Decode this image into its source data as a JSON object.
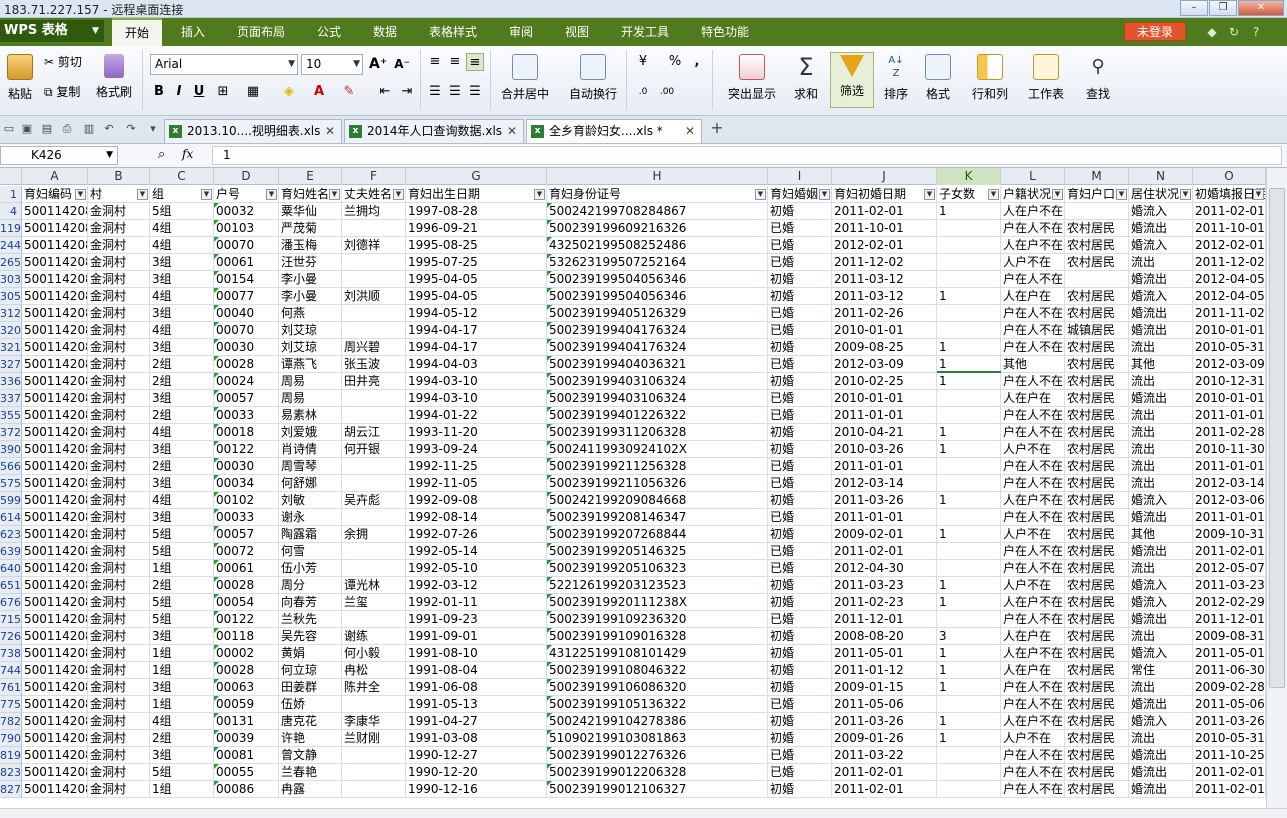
{
  "window": {
    "title": "183.71.227.157 - 远程桌面连接"
  },
  "app": {
    "logo": "WPS 表格",
    "login": "未登录"
  },
  "menu": [
    "开始",
    "插入",
    "页面布局",
    "公式",
    "数据",
    "表格样式",
    "审阅",
    "视图",
    "开发工具",
    "特色功能"
  ],
  "ribbon": {
    "paste": "粘贴",
    "cut": "剪切",
    "copy": "复制",
    "format_painter": "格式刷",
    "font_name": "Arial",
    "font_size": "10",
    "merge_center": "合并居中",
    "wrap_text": "自动换行",
    "percent": "%",
    "highlight": "突出显示",
    "sum": "求和",
    "filter": "筛选",
    "sort": "排序",
    "format": "格式",
    "rows_cols": "行和列",
    "worksheet": "工作表",
    "find": "查找"
  },
  "tabs": [
    {
      "label": "2013.10....视明细表.xls"
    },
    {
      "label": "2014年人口查询数据.xls"
    },
    {
      "label": "全乡育龄妇女....xls *"
    }
  ],
  "formula": {
    "name_box": "K426",
    "fx": "fx",
    "value": "1"
  },
  "columns": [
    "A",
    "B",
    "C",
    "D",
    "E",
    "F",
    "G",
    "H",
    "I",
    "J",
    "K",
    "L",
    "M",
    "N",
    "O"
  ],
  "header_row": {
    "num": "1",
    "cells": [
      "育妇编码",
      "村",
      "组",
      "户号",
      "育妇姓名",
      "丈夫姓名",
      "育妇出生日期",
      "育妇身份证号",
      "育妇婚姻",
      "育妇初婚日期",
      "子女数",
      "户籍状况",
      "育妇户口",
      "居住状况",
      "初婚填报日期"
    ]
  },
  "rows": [
    {
      "num": "4",
      "cells": [
        "500114208",
        "金洞村",
        "5组",
        "00032",
        "粟华仙",
        "兰拥均",
        "1997-08-28",
        "500242199708284867",
        "初婚",
        "2011-02-01",
        "1",
        "人在户不在",
        "",
        "婚流入",
        "2011-02-01"
      ]
    },
    {
      "num": "119",
      "cells": [
        "500114208",
        "金洞村",
        "4组",
        "00103",
        "严茂菊",
        "",
        "1996-09-21",
        "500239199609216326",
        "已婚",
        "2011-10-01",
        "",
        "户在人不在",
        "农村居民",
        "婚流出",
        "2011-10-01"
      ]
    },
    {
      "num": "244",
      "cells": [
        "500114208",
        "金洞村",
        "4组",
        "00070",
        "潘玉梅",
        "刘德祥",
        "1995-08-25",
        "432502199508252486",
        "已婚",
        "2012-02-01",
        "",
        "人在户不在",
        "农村居民",
        "婚流入",
        "2012-02-01"
      ]
    },
    {
      "num": "265",
      "cells": [
        "500114208",
        "金洞村",
        "3组",
        "00061",
        "汪世芬",
        "",
        "1995-07-25",
        "532623199507252164",
        "已婚",
        "2011-12-02",
        "",
        "人户不在",
        "农村居民",
        "流出",
        "2011-12-02"
      ]
    },
    {
      "num": "303",
      "cells": [
        "500114208",
        "金洞村",
        "3组",
        "00154",
        "李小曼",
        "",
        "1995-04-05",
        "500239199504056346",
        "初婚",
        "2011-03-12",
        "",
        "户在人不在",
        "",
        "婚流出",
        "2012-04-05"
      ]
    },
    {
      "num": "305",
      "cells": [
        "500114208",
        "金洞村",
        "4组",
        "00077",
        "李小曼",
        "刘洪顺",
        "1995-04-05",
        "500239199504056346",
        "初婚",
        "2011-03-12",
        "1",
        "人在户在",
        "农村居民",
        "婚流入",
        "2012-04-05"
      ]
    },
    {
      "num": "312",
      "cells": [
        "500114208",
        "金洞村",
        "3组",
        "00040",
        "何燕",
        "",
        "1994-05-12",
        "500239199405126329",
        "已婚",
        "2011-02-26",
        "",
        "户在人不在",
        "农村居民",
        "婚流出",
        "2011-11-02"
      ]
    },
    {
      "num": "320",
      "cells": [
        "500114208",
        "金洞村",
        "4组",
        "00070",
        "刘艾琼",
        "",
        "1994-04-17",
        "500239199404176324",
        "已婚",
        "2010-01-01",
        "",
        "户在人不在",
        "城镇居民",
        "婚流出",
        "2010-01-01"
      ]
    },
    {
      "num": "321",
      "cells": [
        "500114208",
        "金洞村",
        "3组",
        "00030",
        "刘艾琼",
        "周兴碧",
        "1994-04-17",
        "500239199404176324",
        "初婚",
        "2009-08-25",
        "1",
        "户在人不在",
        "农村居民",
        "流出",
        "2010-05-31"
      ]
    },
    {
      "num": "327",
      "cells": [
        "500114208",
        "金洞村",
        "2组",
        "00028",
        "谭燕飞",
        "张玉波",
        "1994-04-03",
        "500239199404036321",
        "已婚",
        "2012-03-09",
        "1",
        "其他",
        "农村居民",
        "其他",
        "2012-03-09"
      ]
    },
    {
      "num": "336",
      "cells": [
        "500114208",
        "金洞村",
        "2组",
        "00024",
        "周易",
        "田井亮",
        "1994-03-10",
        "500239199403106324",
        "初婚",
        "2010-02-25",
        "1",
        "户在人不在",
        "农村居民",
        "流出",
        "2010-12-31"
      ]
    },
    {
      "num": "337",
      "cells": [
        "500114208",
        "金洞村",
        "3组",
        "00057",
        "周易",
        "",
        "1994-03-10",
        "500239199403106324",
        "已婚",
        "2010-01-01",
        "",
        "人在户在",
        "农村居民",
        "婚流出",
        "2010-01-01"
      ]
    },
    {
      "num": "355",
      "cells": [
        "500114208",
        "金洞村",
        "2组",
        "00033",
        "易素林",
        "",
        "1994-01-22",
        "500239199401226322",
        "已婚",
        "2011-01-01",
        "",
        "户在人不在",
        "农村居民",
        "流出",
        "2011-01-01"
      ]
    },
    {
      "num": "372",
      "cells": [
        "500114208",
        "金洞村",
        "4组",
        "00018",
        "刘爱娥",
        "胡云江",
        "1993-11-20",
        "500239199311206328",
        "初婚",
        "2010-04-21",
        "1",
        "户在人不在",
        "农村居民",
        "流出",
        "2011-02-28"
      ]
    },
    {
      "num": "390",
      "cells": [
        "500114208",
        "金洞村",
        "3组",
        "00122",
        "肖诗倩",
        "何开银",
        "1993-09-24",
        "50024119930924102X",
        "初婚",
        "2010-03-26",
        "1",
        "人户不在",
        "农村居民",
        "流出",
        "2010-11-30"
      ]
    },
    {
      "num": "566",
      "cells": [
        "500114208",
        "金洞村",
        "2组",
        "00030",
        "周雪琴",
        "",
        "1992-11-25",
        "500239199211256328",
        "已婚",
        "2011-01-01",
        "",
        "户在人不在",
        "农村居民",
        "流出",
        "2011-01-01"
      ]
    },
    {
      "num": "575",
      "cells": [
        "500114208",
        "金洞村",
        "3组",
        "00034",
        "何舒娜",
        "",
        "1992-11-05",
        "500239199211056326",
        "已婚",
        "2012-03-14",
        "",
        "户在人不在",
        "农村居民",
        "流出",
        "2012-03-14"
      ]
    },
    {
      "num": "599",
      "cells": [
        "500114208",
        "金洞村",
        "4组",
        "00102",
        "刘敏",
        "吴卉彪",
        "1992-09-08",
        "500242199209084668",
        "初婚",
        "2011-03-26",
        "1",
        "人在户不在",
        "农村居民",
        "婚流入",
        "2012-03-06"
      ]
    },
    {
      "num": "614",
      "cells": [
        "500114208",
        "金洞村",
        "3组",
        "00033",
        "谢永",
        "",
        "1992-08-14",
        "500239199208146347",
        "已婚",
        "2011-01-01",
        "",
        "户在人不在",
        "农村居民",
        "婚流出",
        "2011-01-01"
      ]
    },
    {
      "num": "623",
      "cells": [
        "500114208",
        "金洞村",
        "5组",
        "00057",
        "陶露霜",
        "余拥",
        "1992-07-26",
        "500239199207268844",
        "初婚",
        "2009-02-01",
        "1",
        "人户不在",
        "农村居民",
        "其他",
        "2009-10-31"
      ]
    },
    {
      "num": "639",
      "cells": [
        "500114208",
        "金洞村",
        "5组",
        "00072",
        "何雪",
        "",
        "1992-05-14",
        "500239199205146325",
        "已婚",
        "2011-02-01",
        "",
        "户在人不在",
        "农村居民",
        "婚流出",
        "2011-02-01"
      ]
    },
    {
      "num": "640",
      "cells": [
        "500114208",
        "金洞村",
        "1组",
        "00061",
        "伍小芳",
        "",
        "1992-05-10",
        "500239199205106323",
        "已婚",
        "2012-04-30",
        "",
        "户在人不在",
        "农村居民",
        "流出",
        "2012-05-07"
      ]
    },
    {
      "num": "651",
      "cells": [
        "500114208",
        "金洞村",
        "2组",
        "00028",
        "周分",
        "谭光林",
        "1992-03-12",
        "522126199203123523",
        "初婚",
        "2011-03-23",
        "1",
        "人户不在",
        "农村居民",
        "婚流入",
        "2011-03-23"
      ]
    },
    {
      "num": "676",
      "cells": [
        "500114208",
        "金洞村",
        "5组",
        "00054",
        "向春芳",
        "兰玺",
        "1992-01-11",
        "50023919920111238X",
        "初婚",
        "2011-02-23",
        "1",
        "人在户不在",
        "农村居民",
        "婚流入",
        "2012-02-29"
      ]
    },
    {
      "num": "715",
      "cells": [
        "500114208",
        "金洞村",
        "5组",
        "00122",
        "兰秋先",
        "",
        "1991-09-23",
        "500239199109236320",
        "已婚",
        "2011-12-01",
        "",
        "户在人不在",
        "农村居民",
        "婚流出",
        "2011-12-01"
      ]
    },
    {
      "num": "726",
      "cells": [
        "500114208",
        "金洞村",
        "3组",
        "00118",
        "吴先容",
        "谢练",
        "1991-09-01",
        "500239199109016328",
        "初婚",
        "2008-08-20",
        "3",
        "人在户在",
        "农村居民",
        "流出",
        "2009-08-31"
      ]
    },
    {
      "num": "738",
      "cells": [
        "500114208",
        "金洞村",
        "1组",
        "00002",
        "黄娟",
        "何小毅",
        "1991-08-10",
        "431225199108101429",
        "初婚",
        "2011-05-01",
        "1",
        "人在户不在",
        "农村居民",
        "婚流入",
        "2011-05-01"
      ]
    },
    {
      "num": "744",
      "cells": [
        "500114208",
        "金洞村",
        "1组",
        "00028",
        "何立琼",
        "冉松",
        "1991-08-04",
        "500239199108046322",
        "初婚",
        "2011-01-12",
        "1",
        "人在户在",
        "农村居民",
        "常住",
        "2011-06-30"
      ]
    },
    {
      "num": "761",
      "cells": [
        "500114208",
        "金洞村",
        "3组",
        "00063",
        "田姜群",
        "陈井全",
        "1991-06-08",
        "500239199106086320",
        "初婚",
        "2009-01-15",
        "1",
        "户在人不在",
        "农村居民",
        "流出",
        "2009-02-28"
      ]
    },
    {
      "num": "775",
      "cells": [
        "500114208",
        "金洞村",
        "1组",
        "00059",
        "伍娇",
        "",
        "1991-05-13",
        "500239199105136322",
        "已婚",
        "2011-05-06",
        "",
        "户在人不在",
        "农村居民",
        "婚流出",
        "2011-05-06"
      ]
    },
    {
      "num": "782",
      "cells": [
        "500114208",
        "金洞村",
        "4组",
        "00131",
        "唐克花",
        "李康华",
        "1991-04-27",
        "500242199104278386",
        "初婚",
        "2011-03-26",
        "1",
        "人在户不在",
        "农村居民",
        "婚流入",
        "2011-03-26"
      ]
    },
    {
      "num": "790",
      "cells": [
        "500114208",
        "金洞村",
        "2组",
        "00039",
        "许艳",
        "兰财刚",
        "1991-03-08",
        "510902199103081863",
        "初婚",
        "2009-01-26",
        "1",
        "人户不在",
        "农村居民",
        "流出",
        "2010-05-31"
      ]
    },
    {
      "num": "819",
      "cells": [
        "500114208",
        "金洞村",
        "3组",
        "00081",
        "曾文静",
        "",
        "1990-12-27",
        "500239199012276326",
        "已婚",
        "2011-03-22",
        "",
        "户在人不在",
        "农村居民",
        "婚流出",
        "2011-10-25"
      ]
    },
    {
      "num": "823",
      "cells": [
        "500114208",
        "金洞村",
        "5组",
        "00055",
        "兰春艳",
        "",
        "1990-12-20",
        "500239199012206328",
        "已婚",
        "2011-02-01",
        "",
        "户在人不在",
        "农村居民",
        "婚流出",
        "2011-02-01"
      ]
    },
    {
      "num": "827",
      "cells": [
        "500114208",
        "金洞村",
        "1组",
        "00086",
        "冉露",
        "",
        "1990-12-16",
        "500239199012106327",
        "初婚",
        "2011-02-01",
        "",
        "户在人不在",
        "农村居民",
        "婚流出",
        "2011-02-01"
      ]
    }
  ],
  "colors": {
    "accent": "#4f7a1d",
    "login": "#e2552a",
    "selection": "#2e7d32"
  }
}
